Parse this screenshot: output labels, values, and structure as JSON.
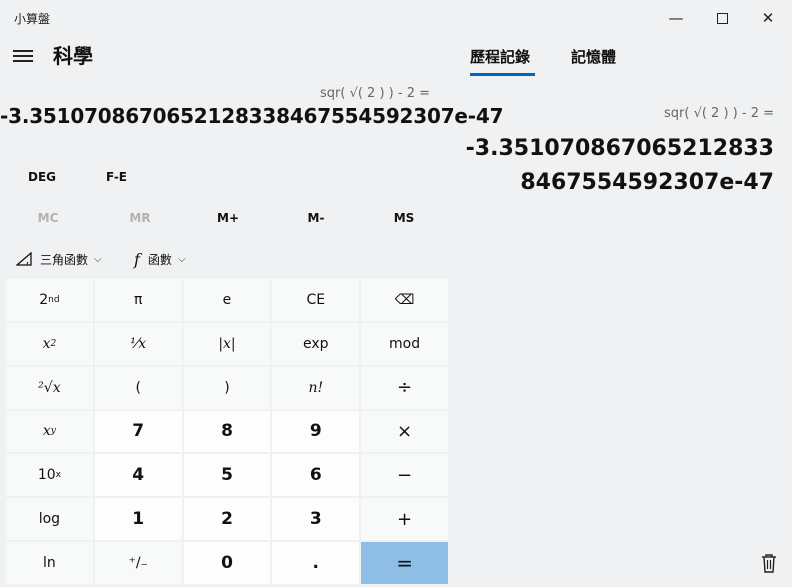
{
  "window": {
    "title": "小算盤",
    "controls": {
      "minimize": "—",
      "close": "✕"
    }
  },
  "header": {
    "mode_title": "科學"
  },
  "display": {
    "expression": "sqr( √( 2 ) ) - 2 =",
    "result": "-3.3510708670652128338467554592307e-47"
  },
  "angle_row": {
    "deg": "DEG",
    "fe": "F-E"
  },
  "memory_row": [
    "MC",
    "MR",
    "M+",
    "M-",
    "MS"
  ],
  "function_row": {
    "trig_icon": "triangle-icon",
    "trig": "三角函數",
    "func_icon": "function-f-icon",
    "func_glyph": "f",
    "func": "函數",
    "chevron": "⌵"
  },
  "keys": {
    "second": "2",
    "second_sup": "nd",
    "pi": "π",
    "e": "e",
    "ce": "CE",
    "backspace": "⌫",
    "square": "x",
    "square_sup": "2",
    "reciprocal": "⅟x",
    "abs": "|x|",
    "exp": "exp",
    "mod": "mod",
    "sqrt": "²√x",
    "lparen": "(",
    "rparen": ")",
    "factorial": "n!",
    "divide": "÷",
    "power": "x",
    "power_sup": "y",
    "n7": "7",
    "n8": "8",
    "n9": "9",
    "multiply": "×",
    "tenpow": "10",
    "tenpow_sup": "x",
    "n4": "4",
    "n5": "5",
    "n6": "6",
    "minus": "−",
    "log": "log",
    "n1": "1",
    "n2": "2",
    "n3": "3",
    "plus": "+",
    "ln": "ln",
    "negate": "⁺/₋",
    "n0": "0",
    "decimal": ".",
    "equals": "="
  },
  "history_panel": {
    "tab_history": "歷程記錄",
    "tab_memory": "記憶體",
    "entry_expression": "sqr( √( 2 ) )  -  2 =",
    "entry_result": "-3.3510708670652128338467554592307e-47"
  },
  "colors": {
    "accent": "#0067c0",
    "equals_key": "#8ebde6"
  }
}
